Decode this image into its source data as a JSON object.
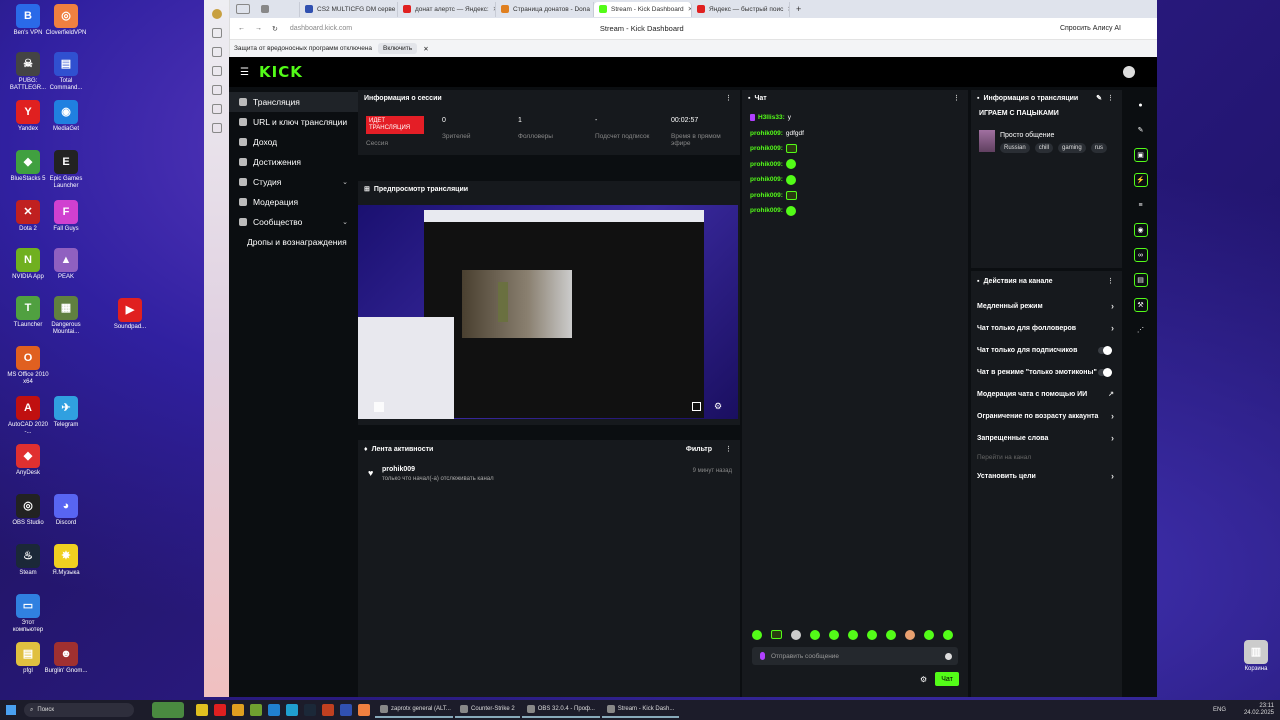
{
  "desktop": {
    "icons": [
      {
        "label": "Ben's VPN",
        "color": "#2a6ae8",
        "glyph": "B"
      },
      {
        "label": "CloverfieldVPN",
        "color": "#f08040",
        "glyph": "◎"
      },
      {
        "label": "PUBG: BATTLEGR...",
        "color": "#444",
        "glyph": "☠"
      },
      {
        "label": "Total Command...",
        "color": "#3050d0",
        "glyph": "▤"
      },
      {
        "label": "Yandex",
        "color": "#e02020",
        "glyph": "Y"
      },
      {
        "label": "MediaGet",
        "color": "#2080e0",
        "glyph": "◉"
      },
      {
        "label": "BlueStacks 5",
        "color": "#40a040",
        "glyph": "◆"
      },
      {
        "label": "Epic Games Launcher",
        "color": "#222",
        "glyph": "E"
      },
      {
        "label": "Dota 2",
        "color": "#c02020",
        "glyph": "✕"
      },
      {
        "label": "Fall Guys",
        "color": "#d040d0",
        "glyph": "F"
      },
      {
        "label": "NVIDIA App",
        "color": "#70b020",
        "glyph": "N"
      },
      {
        "label": "PEAK",
        "color": "#9060c0",
        "glyph": "▲"
      },
      {
        "label": "TLauncher",
        "color": "#50a040",
        "glyph": "T"
      },
      {
        "label": "Dangerous Mountai...",
        "color": "#608040",
        "glyph": "▦"
      },
      {
        "label": "Soundpad...",
        "color": "#e02020",
        "glyph": "▶"
      },
      {
        "label": "MS Office 2010 x64",
        "color": "#e06020",
        "glyph": "O"
      },
      {
        "label": "AutoCAD 2020 -...",
        "color": "#c01010",
        "glyph": "A"
      },
      {
        "label": "Telegram",
        "color": "#30a0e0",
        "glyph": "✈"
      },
      {
        "label": "AnyDesk",
        "color": "#e03030",
        "glyph": "◆"
      },
      {
        "label": "OBS Studio",
        "color": "#222",
        "glyph": "◎"
      },
      {
        "label": "Discord",
        "color": "#5865f2",
        "glyph": "◕"
      },
      {
        "label": "Steam",
        "color": "#1b2838",
        "glyph": "♨"
      },
      {
        "label": "Я.Музыка",
        "color": "#f0d020",
        "glyph": "✸"
      },
      {
        "label": "Этот компьютер",
        "color": "#3080e0",
        "glyph": "▭"
      },
      {
        "label": "pfgl",
        "color": "#e0c040",
        "glyph": "▤"
      },
      {
        "label": "Burglin' Gnom...",
        "color": "#a03030",
        "glyph": "☻"
      },
      {
        "label": "Корзина",
        "color": "#ccc",
        "glyph": "▥"
      }
    ]
  },
  "browser": {
    "tabs": [
      {
        "label": "CS2 MULTICFG DM серве",
        "color": "#888"
      },
      {
        "label": "CS2 MULTICFG DM серве",
        "color": "#3050b0"
      },
      {
        "label": "донат алертс — Яндекс:",
        "color": "#e02020"
      },
      {
        "label": "Страница донатов - Dona",
        "color": "#e08020"
      },
      {
        "label": "Stream - Kick Dashboard",
        "color": "#53fc18"
      },
      {
        "label": "Яндекс — быстрый поис",
        "color": "#e02020"
      }
    ],
    "url": "dashboard.kick.com",
    "page_title": "Stream - Kick Dashboard",
    "alice": "Спросить Алису AI",
    "warning": "Защита от вредоносных программ отключена",
    "warning_button": "Включить"
  },
  "kick": {
    "logo": "KICK",
    "nav": [
      {
        "label": "Трансляция",
        "active": true
      },
      {
        "label": "URL и ключ трансляции"
      },
      {
        "label": "Доход"
      },
      {
        "label": "Достижения"
      },
      {
        "label": "Студия",
        "chev": "⌄"
      },
      {
        "label": "Модерация"
      },
      {
        "label": "Сообщество",
        "chev": "⌄"
      },
      {
        "label": "Дропы и вознаграждения"
      }
    ],
    "session": {
      "title": "Информация о сессии",
      "live": "ИДЕТ ТРАНСЛЯЦИЯ",
      "live_label": "Сессия",
      "viewers": "0",
      "viewers_label": "Зрителей",
      "followers": "1",
      "followers_label": "Фолловеры",
      "subs": "-",
      "subs_label": "Подсчет подписок",
      "time": "00:02:57",
      "time_label": "Время в прямом эфире"
    },
    "preview_title": "Предпросмотр трансляции",
    "activity": {
      "title": "Лента активности",
      "filter": "Фильтр",
      "user": "prohik009",
      "text": "только что начал(-а) отслеживать канал",
      "time": "9 минут назад"
    },
    "chat": {
      "title": "Чат",
      "lines": [
        {
          "user": "H3llis33:",
          "msg": "у"
        },
        {
          "user": "prohik009:",
          "msg": "gdfgdf"
        },
        {
          "user": "prohik009:",
          "msg": ""
        },
        {
          "user": "prohik009:",
          "msg": ""
        },
        {
          "user": "prohik009:",
          "msg": ""
        },
        {
          "user": "prohik009:",
          "msg": ""
        },
        {
          "user": "prohik009:",
          "msg": ""
        }
      ],
      "placeholder": "Отправить сообщение",
      "send": "Чат"
    },
    "stream_info": {
      "title": "Информация о трансляции",
      "stream_title": "ИГРАЕМ С ПАЦЫКАМИ",
      "category": "Просто общение",
      "tags": [
        "Russian",
        "chill",
        "gaming",
        "rus"
      ]
    },
    "actions": {
      "title": "Действия на канале",
      "items": [
        {
          "label": "Медленный режим",
          "kind": "arrow"
        },
        {
          "label": "Чат только для фолловеров",
          "kind": "arrow"
        },
        {
          "label": "Чат только для подписчиков",
          "kind": "toggle"
        },
        {
          "label": "Чат в режиме \"только эмотиконы\"",
          "kind": "toggle"
        },
        {
          "label": "Модерация чата с помощью ИИ",
          "kind": "ext"
        },
        {
          "label": "Ограничение по возрасту аккаунта",
          "kind": "arrow"
        },
        {
          "label": "Запрещенные слова",
          "kind": "arrow"
        },
        {
          "label": "Перейти на канал",
          "kind": "dim"
        },
        {
          "label": "Установить цели",
          "kind": "arrow"
        }
      ]
    }
  },
  "taskbar": {
    "search": "Поиск",
    "windows": [
      {
        "label": "zaprotx general (ALT..."
      },
      {
        "label": "Counter-Strike 2"
      },
      {
        "label": "OBS 32.0.4 - Проф..."
      },
      {
        "label": "Stream - Kick Dash..."
      }
    ],
    "time": "23:11",
    "date": "24.02.2025",
    "lang": "ENG"
  },
  "colors": {
    "accent": "#53fc18",
    "live": "#e41e26",
    "bg": "#0b0e11",
    "panel": "#16191d"
  }
}
